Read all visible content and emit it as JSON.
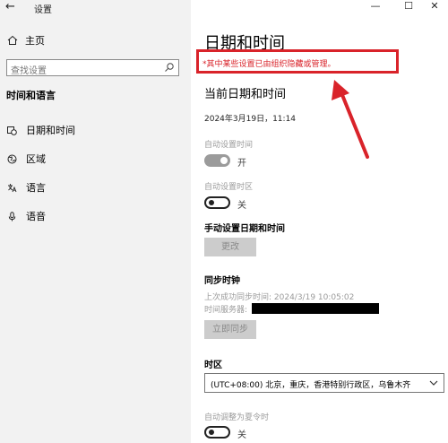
{
  "window": {
    "title": "设置",
    "back_glyph": "←",
    "minimize_glyph": "—",
    "maximize_glyph": "☐",
    "close_glyph": "✕"
  },
  "sidebar": {
    "home_label": "主页",
    "search_placeholder": "查找设置",
    "section_title": "时间和语言",
    "items": [
      {
        "label": "日期和时间",
        "icon": "calendar-clock-icon"
      },
      {
        "label": "区域",
        "icon": "globe-icon"
      },
      {
        "label": "语言",
        "icon": "language-icon"
      },
      {
        "label": "语音",
        "icon": "microphone-icon"
      }
    ]
  },
  "main": {
    "title": "日期和时间",
    "notice": "*其中某些设置已由组织隐藏或管理。",
    "current_heading": "当前日期和时间",
    "current_value": "2024年3月19日，11:14",
    "auto_time_label": "自动设置时间",
    "auto_time_state": "开",
    "auto_zone_label": "自动设置时区",
    "auto_zone_state": "关",
    "manual_heading": "手动设置日期和时间",
    "change_button": "更改",
    "sync_heading": "同步时钟",
    "last_sync": "上次成功同步时间: 2024/3/19 10:05:02",
    "time_server_label": "时间服务器:",
    "sync_button": "立即同步",
    "timezone_heading": "时区",
    "timezone_value": "(UTC+08:00) 北京，重庆，香港特别行政区，乌鲁木齐",
    "dst_label": "自动调整为夏令时",
    "dst_state": "关"
  },
  "colors": {
    "annotation_red": "#d9232a",
    "sidebar_bg": "#f2f2f2",
    "disabled_button_bg": "#cccccc"
  }
}
